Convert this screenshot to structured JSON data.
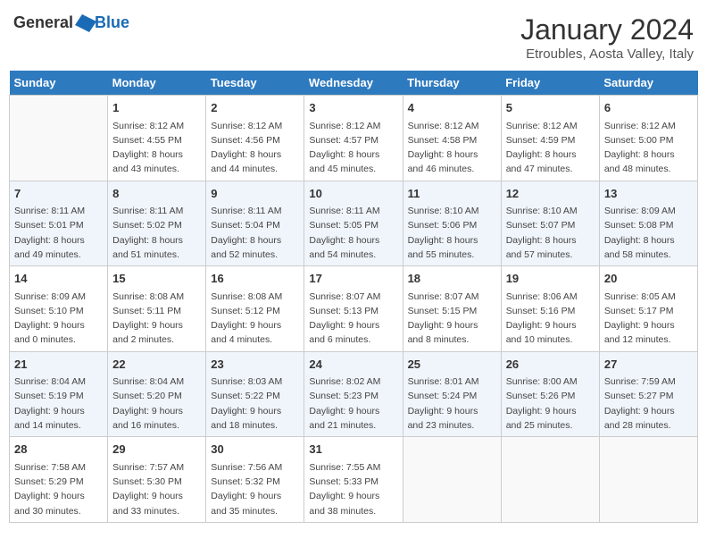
{
  "header": {
    "logo_general": "General",
    "logo_blue": "Blue",
    "month": "January 2024",
    "location": "Etroubles, Aosta Valley, Italy"
  },
  "calendar": {
    "weekdays": [
      "Sunday",
      "Monday",
      "Tuesday",
      "Wednesday",
      "Thursday",
      "Friday",
      "Saturday"
    ],
    "weeks": [
      [
        {
          "day": null
        },
        {
          "day": 1,
          "sunrise": "8:12 AM",
          "sunset": "4:55 PM",
          "daylight": "8 hours and 43 minutes."
        },
        {
          "day": 2,
          "sunrise": "8:12 AM",
          "sunset": "4:56 PM",
          "daylight": "8 hours and 44 minutes."
        },
        {
          "day": 3,
          "sunrise": "8:12 AM",
          "sunset": "4:57 PM",
          "daylight": "8 hours and 45 minutes."
        },
        {
          "day": 4,
          "sunrise": "8:12 AM",
          "sunset": "4:58 PM",
          "daylight": "8 hours and 46 minutes."
        },
        {
          "day": 5,
          "sunrise": "8:12 AM",
          "sunset": "4:59 PM",
          "daylight": "8 hours and 47 minutes."
        },
        {
          "day": 6,
          "sunrise": "8:12 AM",
          "sunset": "5:00 PM",
          "daylight": "8 hours and 48 minutes."
        }
      ],
      [
        {
          "day": 7,
          "sunrise": "8:11 AM",
          "sunset": "5:01 PM",
          "daylight": "8 hours and 49 minutes."
        },
        {
          "day": 8,
          "sunrise": "8:11 AM",
          "sunset": "5:02 PM",
          "daylight": "8 hours and 51 minutes."
        },
        {
          "day": 9,
          "sunrise": "8:11 AM",
          "sunset": "5:04 PM",
          "daylight": "8 hours and 52 minutes."
        },
        {
          "day": 10,
          "sunrise": "8:11 AM",
          "sunset": "5:05 PM",
          "daylight": "8 hours and 54 minutes."
        },
        {
          "day": 11,
          "sunrise": "8:10 AM",
          "sunset": "5:06 PM",
          "daylight": "8 hours and 55 minutes."
        },
        {
          "day": 12,
          "sunrise": "8:10 AM",
          "sunset": "5:07 PM",
          "daylight": "8 hours and 57 minutes."
        },
        {
          "day": 13,
          "sunrise": "8:09 AM",
          "sunset": "5:08 PM",
          "daylight": "8 hours and 58 minutes."
        }
      ],
      [
        {
          "day": 14,
          "sunrise": "8:09 AM",
          "sunset": "5:10 PM",
          "daylight": "9 hours and 0 minutes."
        },
        {
          "day": 15,
          "sunrise": "8:08 AM",
          "sunset": "5:11 PM",
          "daylight": "9 hours and 2 minutes."
        },
        {
          "day": 16,
          "sunrise": "8:08 AM",
          "sunset": "5:12 PM",
          "daylight": "9 hours and 4 minutes."
        },
        {
          "day": 17,
          "sunrise": "8:07 AM",
          "sunset": "5:13 PM",
          "daylight": "9 hours and 6 minutes."
        },
        {
          "day": 18,
          "sunrise": "8:07 AM",
          "sunset": "5:15 PM",
          "daylight": "9 hours and 8 minutes."
        },
        {
          "day": 19,
          "sunrise": "8:06 AM",
          "sunset": "5:16 PM",
          "daylight": "9 hours and 10 minutes."
        },
        {
          "day": 20,
          "sunrise": "8:05 AM",
          "sunset": "5:17 PM",
          "daylight": "9 hours and 12 minutes."
        }
      ],
      [
        {
          "day": 21,
          "sunrise": "8:04 AM",
          "sunset": "5:19 PM",
          "daylight": "9 hours and 14 minutes."
        },
        {
          "day": 22,
          "sunrise": "8:04 AM",
          "sunset": "5:20 PM",
          "daylight": "9 hours and 16 minutes."
        },
        {
          "day": 23,
          "sunrise": "8:03 AM",
          "sunset": "5:22 PM",
          "daylight": "9 hours and 18 minutes."
        },
        {
          "day": 24,
          "sunrise": "8:02 AM",
          "sunset": "5:23 PM",
          "daylight": "9 hours and 21 minutes."
        },
        {
          "day": 25,
          "sunrise": "8:01 AM",
          "sunset": "5:24 PM",
          "daylight": "9 hours and 23 minutes."
        },
        {
          "day": 26,
          "sunrise": "8:00 AM",
          "sunset": "5:26 PM",
          "daylight": "9 hours and 25 minutes."
        },
        {
          "day": 27,
          "sunrise": "7:59 AM",
          "sunset": "5:27 PM",
          "daylight": "9 hours and 28 minutes."
        }
      ],
      [
        {
          "day": 28,
          "sunrise": "7:58 AM",
          "sunset": "5:29 PM",
          "daylight": "9 hours and 30 minutes."
        },
        {
          "day": 29,
          "sunrise": "7:57 AM",
          "sunset": "5:30 PM",
          "daylight": "9 hours and 33 minutes."
        },
        {
          "day": 30,
          "sunrise": "7:56 AM",
          "sunset": "5:32 PM",
          "daylight": "9 hours and 35 minutes."
        },
        {
          "day": 31,
          "sunrise": "7:55 AM",
          "sunset": "5:33 PM",
          "daylight": "9 hours and 38 minutes."
        },
        {
          "day": null
        },
        {
          "day": null
        },
        {
          "day": null
        }
      ]
    ]
  }
}
